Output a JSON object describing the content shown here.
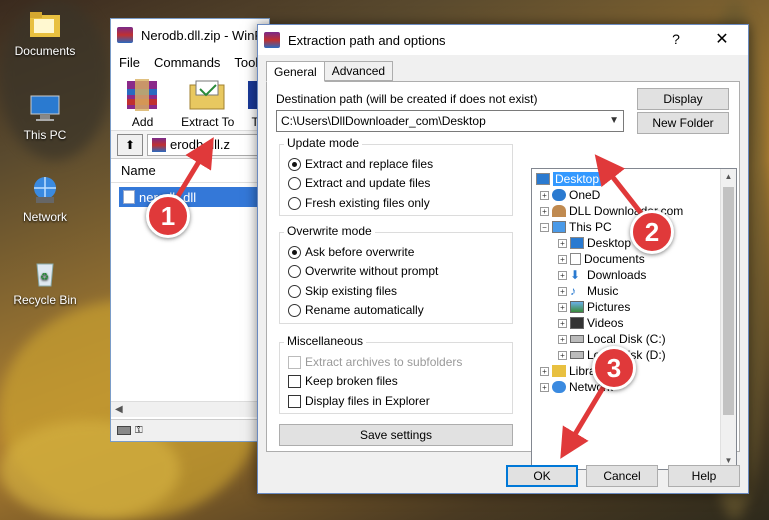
{
  "desktop": {
    "icons": [
      {
        "label": "Documents",
        "icon": "folder-icon"
      },
      {
        "label": "This PC",
        "icon": "computer-icon"
      },
      {
        "label": "Network",
        "icon": "network-icon"
      },
      {
        "label": "Recycle Bin",
        "icon": "recycle-bin-icon"
      }
    ]
  },
  "winrar": {
    "title": "Nerodb.dll.zip - WinR",
    "menu": [
      "File",
      "Commands",
      "Tools"
    ],
    "toolbar": {
      "add_label": "Add",
      "extract_label": "Extract To",
      "partial_label": "T"
    },
    "path": "erodb.dll.z",
    "column_name": "Name",
    "selected_file": "nerodb.dll"
  },
  "dialog": {
    "title": "Extraction path and options",
    "help": "?",
    "close": "✕",
    "tabs": [
      "General",
      "Advanced"
    ],
    "dest_label": "Destination path (will be created if does not exist)",
    "dest_value": "C:\\Users\\DllDownloader_com\\Desktop",
    "display_button": "Display",
    "new_folder_button": "New Folder",
    "update_mode": {
      "title": "Update mode",
      "options": [
        "Extract and replace files",
        "Extract and update files",
        "Fresh existing files only"
      ],
      "selected": 0
    },
    "overwrite_mode": {
      "title": "Overwrite mode",
      "options": [
        "Ask before overwrite",
        "Overwrite without prompt",
        "Skip existing files",
        "Rename automatically"
      ],
      "selected": 0
    },
    "misc": {
      "title": "Miscellaneous",
      "options": [
        "Extract archives to subfolders",
        "Keep broken files",
        "Display files in Explorer"
      ]
    },
    "save_settings": "Save settings",
    "tree": [
      {
        "label": "Desktop",
        "level": 0,
        "selected": true
      },
      {
        "label": "OneD",
        "level": 1,
        "icon": "cloud-icon"
      },
      {
        "label": "DLL Downloader.com",
        "level": 1,
        "icon": "user-icon"
      },
      {
        "label": "This PC",
        "level": 1,
        "icon": "computer-icon"
      },
      {
        "label": "Desktop",
        "level": 2,
        "icon": "desktop-icon"
      },
      {
        "label": "Documents",
        "level": 2,
        "icon": "document-icon"
      },
      {
        "label": "Downloads",
        "level": 2,
        "icon": "download-icon"
      },
      {
        "label": "Music",
        "level": 2,
        "icon": "music-icon"
      },
      {
        "label": "Pictures",
        "level": 2,
        "icon": "pictures-icon"
      },
      {
        "label": "Videos",
        "level": 2,
        "icon": "videos-icon"
      },
      {
        "label": "Local Disk (C:)",
        "level": 2,
        "icon": "disk-icon"
      },
      {
        "label": "Local Disk (D:)",
        "level": 2,
        "icon": "disk-icon"
      },
      {
        "label": "Libraries",
        "level": 1,
        "icon": "library-icon"
      },
      {
        "label": "Network",
        "level": 1,
        "icon": "network-icon"
      }
    ],
    "ok": "OK",
    "cancel": "Cancel",
    "help_button": "Help"
  },
  "annotations": [
    "1",
    "2",
    "3"
  ],
  "colors": {
    "selection": "#3399ff",
    "badge": "#e0393a",
    "accent": "#0078d7"
  }
}
